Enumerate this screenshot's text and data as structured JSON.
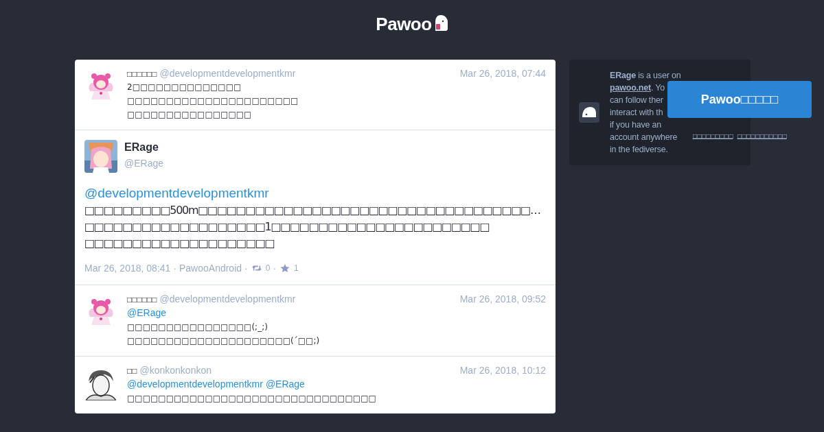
{
  "logo": {
    "text": "Pawoo"
  },
  "statuses": [
    {
      "kind": "compact",
      "display_name": "□□□□□□",
      "acct": "@developmentdevelopmentkmr",
      "time": "Mar 26, 2018, 07:44",
      "content": [
        [
          {
            "kind": "text",
            "text": "2□□□□□□□□□□□□□□"
          }
        ],
        [
          {
            "kind": "text",
            "text": "□□□□□□□□□□□□□□□□□□□□□□"
          }
        ],
        [
          {
            "kind": "text",
            "text": "□□□□□□□□□□□□□□□□"
          }
        ]
      ]
    },
    {
      "kind": "detailed",
      "display_name": "ERage",
      "acct": "@ERage",
      "content": [
        [
          {
            "kind": "mention",
            "text": "@developmentdevelopmentkmr"
          }
        ],
        [
          {
            "kind": "text",
            "text": "□□□□□□□□□500m□□□□□□□□□□□□□□□□□□□□□□□□□□□□□□□□□□□…"
          }
        ],
        [
          {
            "kind": "text",
            "text": "□□□□□□□□□□□□□□□□□□□1□□□□□□□□□□□□□□□□□□□□□□□"
          }
        ],
        [
          {
            "kind": "text",
            "text": "□□□□□□□□□□□□□□□□□□□□"
          }
        ]
      ],
      "meta": {
        "time": "Mar 26, 2018, 08:41",
        "separator": "·",
        "application": "PawooAndroid",
        "reblogs": "0",
        "favourites": "1"
      }
    },
    {
      "kind": "compact",
      "display_name": "□□□□□□",
      "acct": "@developmentdevelopmentkmr",
      "time": "Mar 26, 2018, 09:52",
      "content": [
        [
          {
            "kind": "mention",
            "text": "@ERage"
          }
        ],
        [
          {
            "kind": "text",
            "text": "□□□□□□□□□□□□□□□□(;_;)"
          }
        ],
        [
          {
            "kind": "text",
            "text": "□□□□□□□□□□□□□□□□□□□□□(´□□;)"
          }
        ]
      ]
    },
    {
      "kind": "compact",
      "display_name": "□□",
      "acct": "@konkonkonkon",
      "time": "Mar 26, 2018, 10:12",
      "content": [
        [
          {
            "kind": "mention",
            "text": "@developmentdevelopmentkmr"
          },
          {
            "kind": "mention",
            "text": "@ERage"
          },
          {
            "kind": "text",
            "text": " □□□□□□□□□□□□□□□□□□□□□□□□□□□□□□□□"
          }
        ]
      ]
    }
  ],
  "account_card": {
    "lines": [
      [
        {
          "kind": "bold",
          "text": "ERage"
        },
        {
          "kind": "text",
          "text": " is a user on"
        }
      ],
      [
        {
          "kind": "link",
          "text": "pawoo.net"
        },
        {
          "kind": "text",
          "text": ". Yo"
        }
      ],
      [
        {
          "kind": "text",
          "text": "can follow ther"
        }
      ],
      [
        {
          "kind": "text",
          "text": "interact with th"
        }
      ],
      [
        {
          "kind": "text",
          "text": "if you have an"
        }
      ],
      [
        {
          "kind": "text",
          "text": "account anywhere"
        }
      ],
      [
        {
          "kind": "text",
          "text": "in the fediverse."
        }
      ]
    ],
    "button": "Pawoo□□□□□",
    "links": [
      "□□□□□□□□□",
      "□□□□□□□□□□□"
    ]
  }
}
